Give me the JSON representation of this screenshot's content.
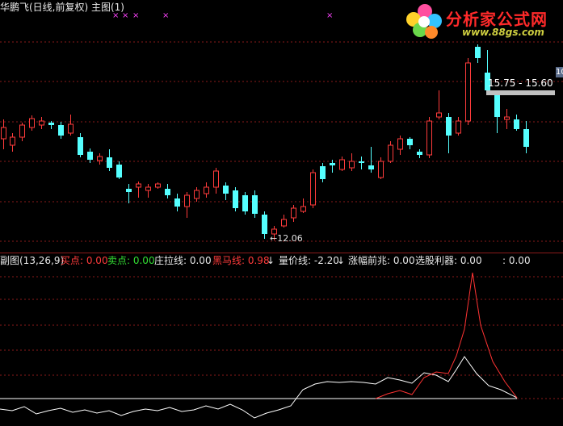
{
  "header": {
    "title": "华鹏飞(日线,前复权) 主图(1)"
  },
  "logo": {
    "name": "分析家公式网",
    "url": "www.88gs.com"
  },
  "annotations": {
    "range_label": "15.75 - 15.60",
    "low_label": "←12.06",
    "edge_tag": "10"
  },
  "subchart_header": {
    "name": "副图(13,26,9)",
    "buy": "买点: 0.00",
    "sell": "卖点: 0.00",
    "zhuang": "庄拉线: 0.00",
    "heima": "黑马线: 0.98",
    "liangjia": "量价线: -2.20",
    "zhangfu": "涨幅前兆: 0.00",
    "xuangu": "选股利器: 0.00",
    "extra": ": 0.00"
  },
  "colors": {
    "background": "#000000",
    "up_candle": "#ff3b3b",
    "down_candle": "#55ffff",
    "grid": "#8a1a1a",
    "marker": "#ff44ff",
    "highlight_bar": "#c0c0c0"
  }
}
